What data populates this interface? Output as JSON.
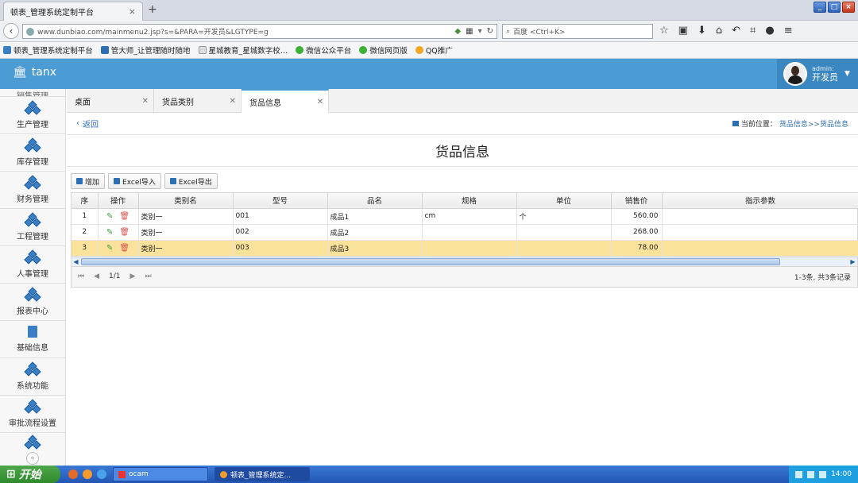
{
  "browser": {
    "tab_title": "顿表_管理系统定制平台",
    "url": "www.dunbiao.com/mainmenu2.jsp?s=&PARA=开发员&LGTYPE=g",
    "search_placeholder": "百度 <Ctrl+K>",
    "bookmarks": [
      {
        "label": "顿表_管理系统定制平台",
        "color": "#3a7fc4"
      },
      {
        "label": "管大师_让管理随时随地",
        "color": "#2d6fb3"
      },
      {
        "label": "星城教育_星城数字校…",
        "color": "#dddddd"
      },
      {
        "label": "微信公众平台",
        "color": "#3cb034"
      },
      {
        "label": "微信网页版",
        "color": "#3cb034"
      },
      {
        "label": "QQ推广",
        "color": "#f5a623"
      }
    ]
  },
  "app": {
    "logo": "tanx",
    "user_role": "admin:",
    "user_name": "开发员"
  },
  "sidebar": {
    "partial_top": "销售管理",
    "items": [
      {
        "label": "生产管理",
        "icon": "cubes-icon"
      },
      {
        "label": "库存管理",
        "icon": "cubes-icon"
      },
      {
        "label": "财务管理",
        "icon": "cubes-icon"
      },
      {
        "label": "工程管理",
        "icon": "cubes-icon"
      },
      {
        "label": "人事管理",
        "icon": "cubes-icon"
      },
      {
        "label": "报表中心",
        "icon": "cubes-icon"
      },
      {
        "label": "基础信息",
        "icon": "document-icon"
      },
      {
        "label": "系统功能",
        "icon": "cubes-icon"
      },
      {
        "label": "审批流程设置",
        "icon": "cubes-icon"
      }
    ]
  },
  "tabs": [
    {
      "label": "桌面"
    },
    {
      "label": "货品类别"
    },
    {
      "label": "货品信息"
    }
  ],
  "crumb": {
    "back": "返回",
    "prefix": "当前位置：",
    "path": "货品信息>>货品信息"
  },
  "page": {
    "title": "货品信息"
  },
  "toolbar": {
    "add": "增加",
    "import": "Excel导入",
    "export": "Excel导出"
  },
  "table": {
    "headers": [
      "序",
      "操作",
      "类别名",
      "型号",
      "品名",
      "规格",
      "单位",
      "销售价",
      "指示参数"
    ],
    "rows": [
      {
        "idx": "1",
        "category": "类别一",
        "model": "001",
        "name": "成品1",
        "spec": "cm",
        "unit": "个",
        "price": "560.00",
        "param": ""
      },
      {
        "idx": "2",
        "category": "类别一",
        "model": "002",
        "name": "成品2",
        "spec": "",
        "unit": "",
        "price": "268.00",
        "param": ""
      },
      {
        "idx": "3",
        "category": "类别一",
        "model": "003",
        "name": "成品3",
        "spec": "",
        "unit": "",
        "price": "78.00",
        "param": ""
      }
    ]
  },
  "pager": {
    "page": "1/1",
    "summary": "1-3条, 共3条记录"
  },
  "taskbar": {
    "start": "开始",
    "tasks": [
      "ocam",
      "顿表_管理系统定..."
    ],
    "clock": "14:00"
  }
}
